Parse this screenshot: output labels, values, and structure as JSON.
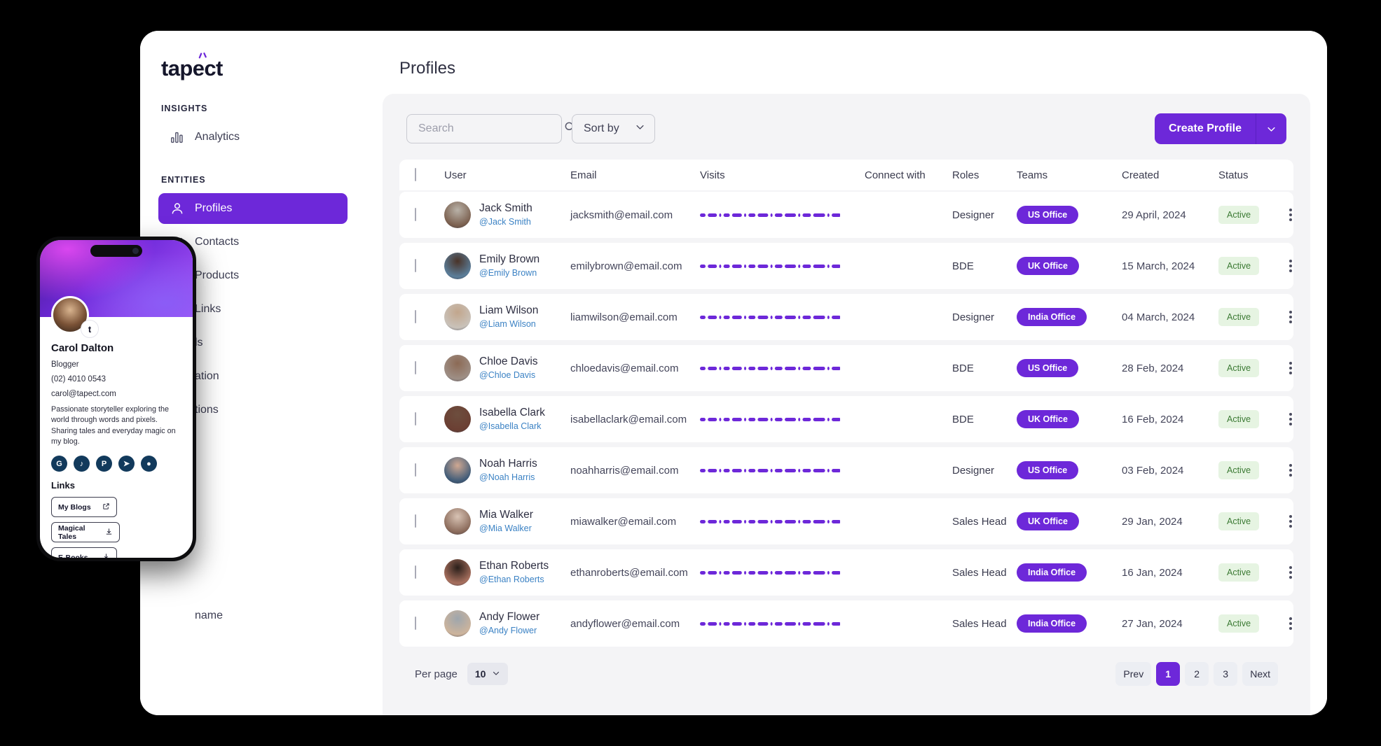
{
  "brand": {
    "logo_text": "tapect",
    "accent": "#6d28d9"
  },
  "sidebar": {
    "groups": [
      {
        "label": "INSIGHTS",
        "items": [
          {
            "label": "Analytics",
            "icon": "analytics-icon",
            "active": false
          }
        ]
      },
      {
        "label": "ENTITIES",
        "items": [
          {
            "label": "Profiles",
            "icon": "profile-icon",
            "active": true
          },
          {
            "label": "Contacts",
            "icon": "contacts-icon",
            "active": false
          },
          {
            "label": "Products",
            "icon": "products-icon",
            "active": false
          },
          {
            "label": "Links",
            "icon": "links-icon",
            "active": false
          },
          {
            "label": "ls",
            "icon": "hidden-icon",
            "active": false
          },
          {
            "label": "ation",
            "icon": "hidden-icon",
            "active": false
          },
          {
            "label": "tions",
            "icon": "hidden-icon",
            "active": false
          },
          {
            "label": "name",
            "icon": "hidden-icon",
            "active": false
          }
        ]
      }
    ]
  },
  "header": {
    "title": "Profiles"
  },
  "toolbar": {
    "search_placeholder": "Search",
    "search_value": "",
    "search_icon": "search-icon",
    "sort_label": "Sort by",
    "sort_icon": "chevron-down-icon",
    "create_label": "Create Profile",
    "create_caret_icon": "chevron-down-icon"
  },
  "table": {
    "columns": [
      "User",
      "Email",
      "Visits",
      "Connect with",
      "Roles",
      "Teams",
      "Created",
      "Status"
    ],
    "rows": [
      {
        "name": "Jack Smith",
        "handle": "@Jack Smith",
        "email": "jacksmith@email.com",
        "role": "Designer",
        "team": "US Office",
        "created": "29 April, 2024",
        "status": "Active",
        "av": "#b9b2a8",
        "av2": "#7a5f4e"
      },
      {
        "name": "Emily Brown",
        "handle": "@Emily Brown",
        "email": "emilybrown@email.com",
        "role": "BDE",
        "team": "UK Office",
        "created": "15 March, 2024",
        "status": "Active",
        "av": "#4a3328",
        "av2": "#5b7e9a"
      },
      {
        "name": "Liam Wilson",
        "handle": "@Liam Wilson",
        "email": "liamwilson@email.com",
        "role": "Designer",
        "team": "India Office",
        "created": "04 March, 2024",
        "status": "Active",
        "av": "#c2a68c",
        "av2": "#c9c2ba"
      },
      {
        "name": "Chloe Davis",
        "handle": "@Chloe Davis",
        "email": "chloedavis@email.com",
        "role": "BDE",
        "team": "US Office",
        "created": "28 Feb, 2024",
        "status": "Active",
        "av": "#8c6a55",
        "av2": "#9e8f86"
      },
      {
        "name": "Isabella Clark",
        "handle": "@Isabella Clark",
        "email": "isabellaclark@email.com",
        "role": "BDE",
        "team": "UK Office",
        "created": "16 Feb, 2024",
        "status": "Active",
        "av": "#6d4e3e",
        "av2": "#6b3f33"
      },
      {
        "name": "Noah Harris",
        "handle": "@Noah Harris",
        "email": "noahharris@email.com",
        "role": "Designer",
        "team": "US Office",
        "created": "03 Feb, 2024",
        "status": "Active",
        "av": "#cfa892",
        "av2": "#3f5b78"
      },
      {
        "name": "Mia Walker",
        "handle": "@Mia Walker",
        "email": "miawalker@email.com",
        "role": "Sales Head",
        "team": "UK Office",
        "created": "29 Jan, 2024",
        "status": "Active",
        "av": "#d8c3b4",
        "av2": "#8a6a5a"
      },
      {
        "name": "Ethan Roberts",
        "handle": "@Ethan Roberts",
        "email": "ethanroberts@email.com",
        "role": "Sales Head",
        "team": "India Office",
        "created": "16 Jan, 2024",
        "status": "Active",
        "av": "#2a1f1a",
        "av2": "#a8705e"
      },
      {
        "name": "Andy Flower",
        "handle": "@Andy Flower",
        "email": "andyflower@email.com",
        "role": "Sales Head",
        "team": "India Office",
        "created": "27 Jan, 2024",
        "status": "Active",
        "av": "#9ea6ad",
        "av2": "#cdb49c"
      }
    ]
  },
  "footer": {
    "per_page_label": "Per page",
    "per_page_value": "10",
    "per_page_icon": "chevron-down-icon",
    "pager": [
      {
        "label": "Prev",
        "active": false
      },
      {
        "label": "1",
        "active": true
      },
      {
        "label": "2",
        "active": false
      },
      {
        "label": "3",
        "active": false
      },
      {
        "label": "Next",
        "active": false
      }
    ]
  },
  "phone_card": {
    "name": "Carol Dalton",
    "role": "Blogger",
    "phone": "(02) 4010 0543",
    "email": "carol@tapect.com",
    "bio": "Passionate storyteller exploring the world through words and pixels. Sharing tales and everyday magic on my blog.",
    "badge_glyph": "t",
    "socials": [
      {
        "name": "google-icon",
        "glyph": "G"
      },
      {
        "name": "tiktok-icon",
        "glyph": "♪"
      },
      {
        "name": "pinterest-icon",
        "glyph": "P"
      },
      {
        "name": "telegram-icon",
        "glyph": "➤"
      },
      {
        "name": "location-icon",
        "glyph": "●"
      }
    ],
    "links_title": "Links",
    "links": [
      {
        "label": "My Blogs",
        "icon": "external-link-icon"
      },
      {
        "label": "Magical Tales",
        "icon": "download-icon"
      },
      {
        "label": "E-Books",
        "icon": "download-icon"
      }
    ]
  }
}
